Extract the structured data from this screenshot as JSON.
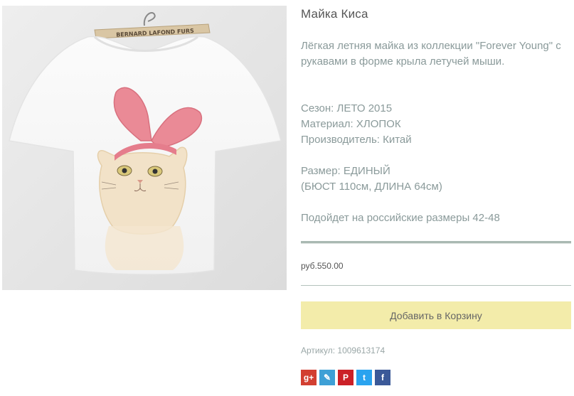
{
  "product": {
    "title": "Майка Киса",
    "description": "Лёгкая летняя майка из коллекции \"Forever Young\" с рукавами в форме крыла летучей мыши.",
    "season": "Сезон: ЛЕТО 2015",
    "material": "Материал: ХЛОПОК",
    "manufacturer": "Производитель: Китай",
    "size": "Размер: ЕДИНЫЙ",
    "size_detail": "(БЮСТ 110см, ДЛИНА 64см)",
    "fit": "Подойдет на российские размеры 42-48",
    "price": "руб.550.00",
    "add_to_cart": "Добавить в Корзину",
    "sku": "Артикул: 1009613174"
  },
  "image": {
    "hanger_text": "BERNARD LAFOND FURS",
    "hanger_text_small": "FURS"
  },
  "social": [
    {
      "icon": "google-plus-icon",
      "glyph": "g+",
      "color": "#d23f31"
    },
    {
      "icon": "livejournal-icon",
      "glyph": "✎",
      "color": "#3ea0d6"
    },
    {
      "icon": "pinterest-icon",
      "glyph": "P",
      "color": "#cb2027"
    },
    {
      "icon": "twitter-icon",
      "glyph": "t",
      "color": "#2aa3ef"
    },
    {
      "icon": "facebook-icon",
      "glyph": "f",
      "color": "#3b5998"
    }
  ],
  "colors": {
    "cart_button": "#f3ecaa",
    "text_muted": "#8a9a9a",
    "divider": "#a9b9b2"
  }
}
